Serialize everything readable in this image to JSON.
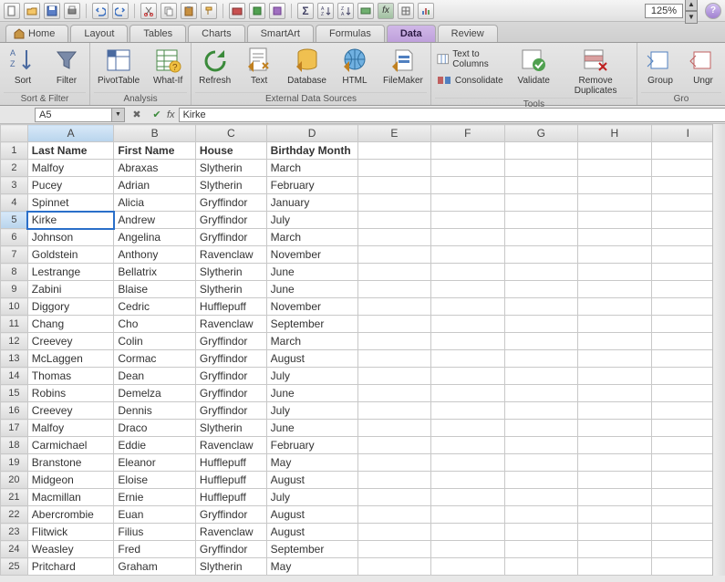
{
  "toolbar": {
    "zoom": "125%"
  },
  "ribbon_tabs": [
    "Home",
    "Layout",
    "Tables",
    "Charts",
    "SmartArt",
    "Formulas",
    "Data",
    "Review"
  ],
  "active_tab": "Data",
  "ribbon": {
    "groups": [
      {
        "label": "Sort & Filter",
        "buttons": [
          {
            "id": "sort",
            "label": "Sort"
          },
          {
            "id": "filter",
            "label": "Filter"
          }
        ]
      },
      {
        "label": "Analysis",
        "buttons": [
          {
            "id": "pivot",
            "label": "PivotTable"
          },
          {
            "id": "whatif",
            "label": "What-If"
          }
        ]
      },
      {
        "label": "External Data Sources",
        "buttons": [
          {
            "id": "refresh",
            "label": "Refresh"
          },
          {
            "id": "text",
            "label": "Text"
          },
          {
            "id": "database",
            "label": "Database"
          },
          {
            "id": "html",
            "label": "HTML"
          },
          {
            "id": "filemaker",
            "label": "FileMaker"
          }
        ]
      },
      {
        "label": "Tools",
        "buttons": [
          {
            "id": "texttocol",
            "label": "Text to Columns"
          },
          {
            "id": "consolidate",
            "label": "Consolidate"
          },
          {
            "id": "validate",
            "label": "Validate"
          },
          {
            "id": "removedup",
            "label": "Remove Duplicates"
          }
        ]
      },
      {
        "label": "Gro",
        "buttons": [
          {
            "id": "group",
            "label": "Group"
          },
          {
            "id": "ungroup",
            "label": "Ungr"
          }
        ]
      }
    ]
  },
  "namebox": "A5",
  "formula": "Kirke",
  "columns": [
    "A",
    "B",
    "C",
    "D",
    "E",
    "F",
    "G",
    "H",
    "I"
  ],
  "headers": [
    "Last Name",
    "First Name",
    "House",
    "Birthday Month"
  ],
  "selected_cell": {
    "row": 5,
    "col": 0
  },
  "rows": [
    [
      "Malfoy",
      "Abraxas",
      "Slytherin",
      "March"
    ],
    [
      "Pucey",
      "Adrian",
      "Slytherin",
      "February"
    ],
    [
      "Spinnet",
      "Alicia",
      "Gryffindor",
      "January"
    ],
    [
      "Kirke",
      "Andrew",
      "Gryffindor",
      "July"
    ],
    [
      "Johnson",
      "Angelina",
      "Gryffindor",
      "March"
    ],
    [
      "Goldstein",
      "Anthony",
      "Ravenclaw",
      "November"
    ],
    [
      "Lestrange",
      "Bellatrix",
      "Slytherin",
      "June"
    ],
    [
      "Zabini",
      "Blaise",
      "Slytherin",
      "June"
    ],
    [
      "Diggory",
      "Cedric",
      "Hufflepuff",
      "November"
    ],
    [
      "Chang",
      "Cho",
      "Ravenclaw",
      "September"
    ],
    [
      "Creevey",
      "Colin",
      "Gryffindor",
      "March"
    ],
    [
      "McLaggen",
      "Cormac",
      "Gryffindor",
      "August"
    ],
    [
      "Thomas",
      "Dean",
      "Gryffindor",
      "July"
    ],
    [
      "Robins",
      "Demelza",
      "Gryffindor",
      "June"
    ],
    [
      "Creevey",
      "Dennis",
      "Gryffindor",
      "July"
    ],
    [
      "Malfoy",
      "Draco",
      "Slytherin",
      "June"
    ],
    [
      "Carmichael",
      "Eddie",
      "Ravenclaw",
      "February"
    ],
    [
      "Branstone",
      "Eleanor",
      "Hufflepuff",
      "May"
    ],
    [
      "Midgeon",
      "Eloise",
      "Hufflepuff",
      "August"
    ],
    [
      "Macmillan",
      "Ernie",
      "Hufflepuff",
      "July"
    ],
    [
      "Abercrombie",
      "Euan",
      "Gryffindor",
      "August"
    ],
    [
      "Flitwick",
      "Filius",
      "Ravenclaw",
      "August"
    ],
    [
      "Weasley",
      "Fred",
      "Gryffindor",
      "September"
    ],
    [
      "Pritchard",
      "Graham",
      "Slytherin",
      "May"
    ]
  ]
}
